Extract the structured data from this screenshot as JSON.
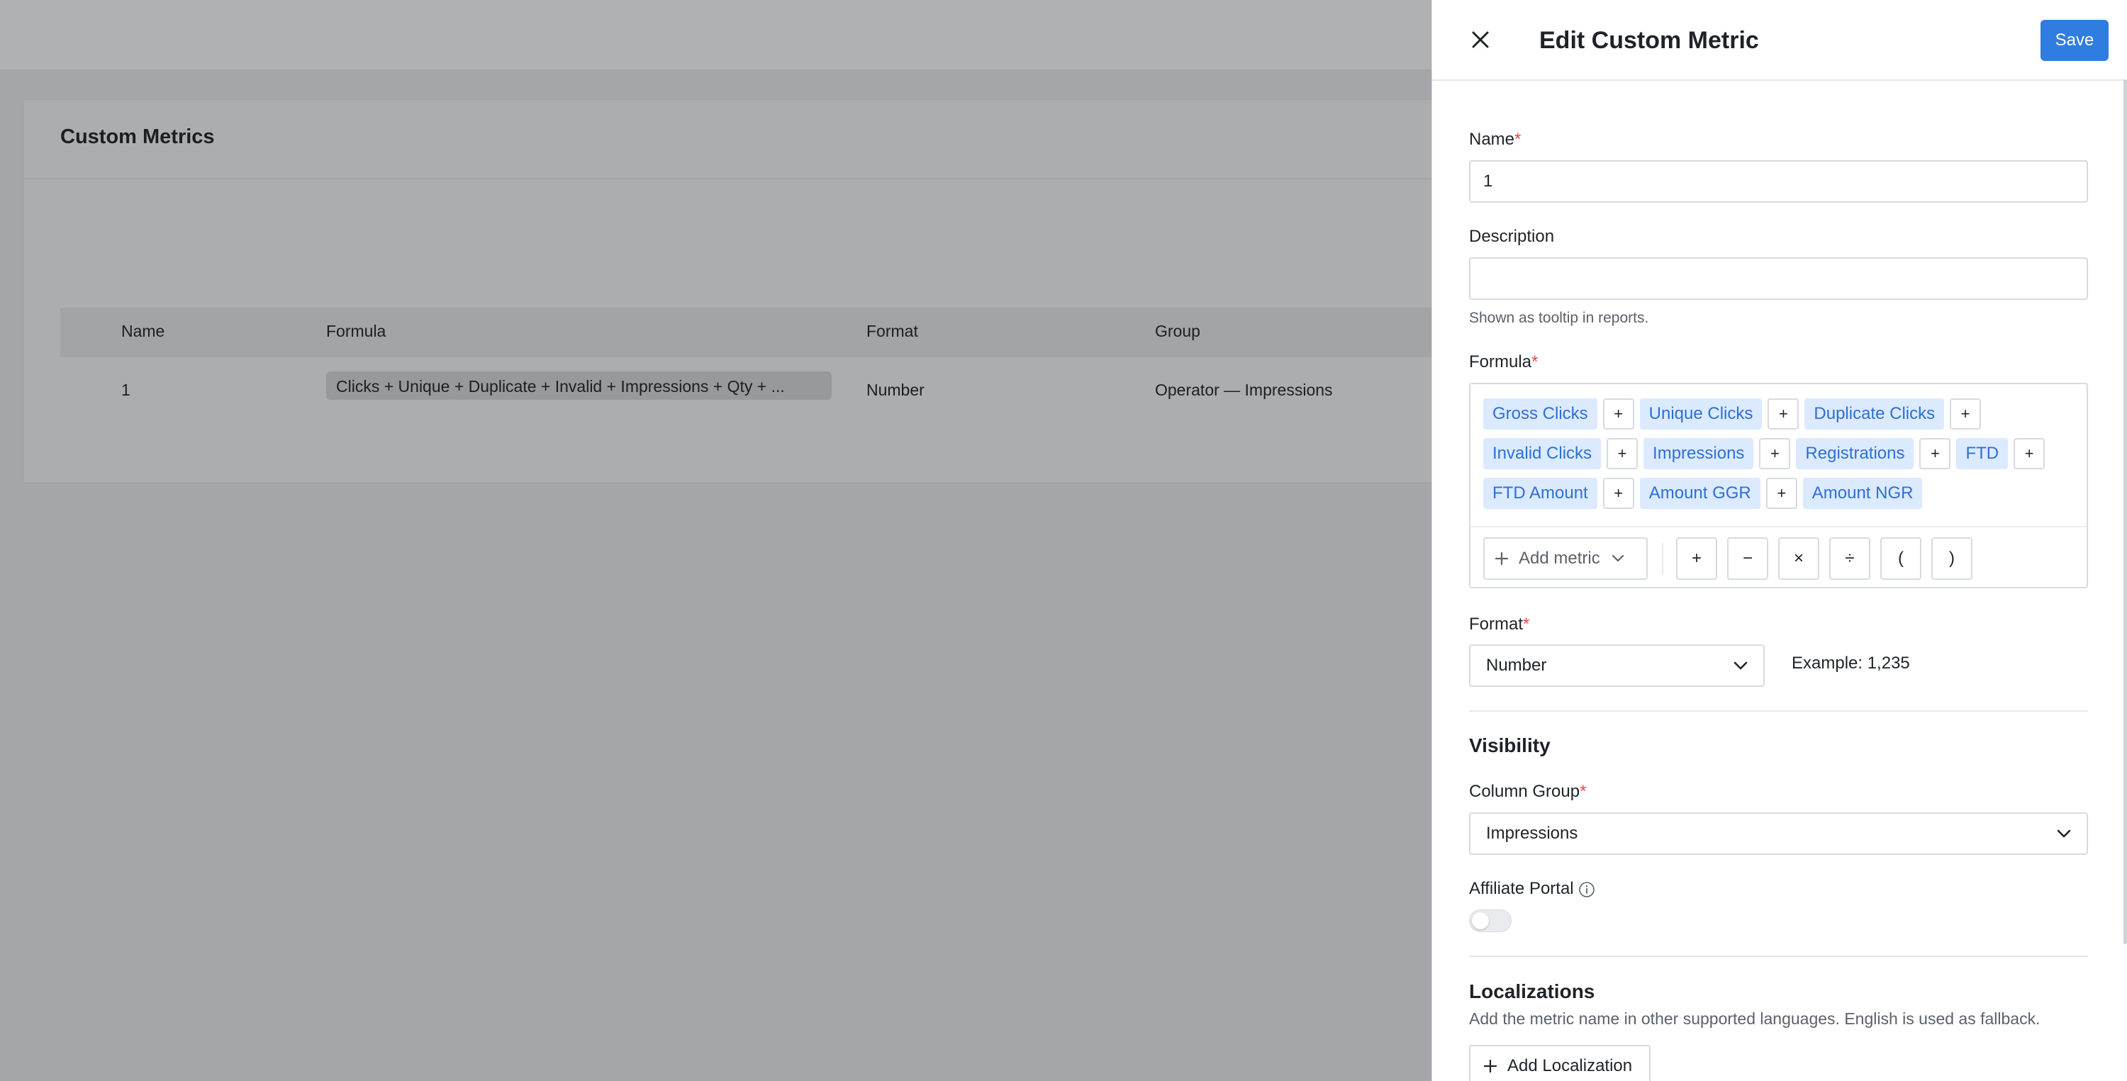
{
  "background": {
    "card_title": "Custom Metrics",
    "table": {
      "headers": [
        "Name",
        "Formula",
        "Format",
        "Group"
      ],
      "rows": [
        {
          "name": "1",
          "formula": "Clicks + Unique + Duplicate + Invalid + Impressions + Qty + ...",
          "format": "Number",
          "group": "Operator — Impressions"
        }
      ]
    }
  },
  "drawer": {
    "title": "Edit Custom Metric",
    "save_label": "Save",
    "name": {
      "label": "Name",
      "required_mark": "*",
      "value": "1"
    },
    "description": {
      "label": "Description",
      "value": "",
      "help": "Shown as tooltip in reports."
    },
    "formula": {
      "label": "Formula",
      "required_mark": "*",
      "rows": [
        [
          "Gross Clicks",
          "+",
          "Unique Clicks",
          "+",
          "Duplicate Clicks",
          "+"
        ],
        [
          "Invalid Clicks",
          "+",
          "Impressions",
          "+",
          "Registrations",
          "+",
          "FTD",
          "+"
        ],
        [
          "FTD Amount",
          "+",
          "Amount GGR",
          "+",
          "Amount NGR"
        ]
      ],
      "add_metric_label": "Add metric",
      "operators": [
        "+",
        "−",
        "×",
        "÷",
        "(",
        ")"
      ]
    },
    "format": {
      "label": "Format",
      "required_mark": "*",
      "value": "Number",
      "example": "Example: 1,235"
    },
    "visibility": {
      "title": "Visibility",
      "column_group": {
        "label": "Column Group",
        "required_mark": "*",
        "value": "Impressions"
      },
      "affiliate_portal": {
        "label": "Affiliate Portal",
        "enabled": false
      }
    },
    "localizations": {
      "title": "Localizations",
      "description": "Add the metric name in other supported languages. English is used as fallback.",
      "add_label": "Add Localization"
    }
  },
  "colors": {
    "primary": "#2f7de1",
    "chip_bg": "#dbeafe",
    "chip_text": "#2f6fd6",
    "required": "#e5484d"
  }
}
